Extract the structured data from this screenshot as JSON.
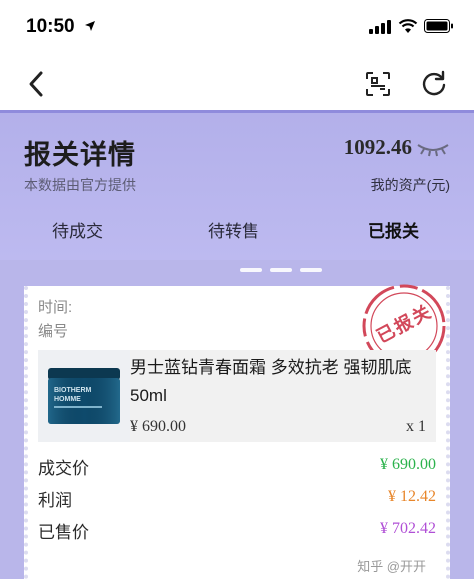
{
  "status_bar": {
    "time": "10:50"
  },
  "header": {
    "title": "报关详情",
    "subtitle": "本数据由官方提供",
    "asset_value": "1092.46",
    "asset_label": "我的资产(元)"
  },
  "tabs": [
    {
      "label": "待成交",
      "active": false
    },
    {
      "label": "待转售",
      "active": false
    },
    {
      "label": "已报关",
      "active": true
    }
  ],
  "card": {
    "time_label": "时间:",
    "id_label": "编号",
    "stamp": "已报关",
    "product": {
      "name": "男士蓝钻青春面霜 多效抗老 强韧肌底50ml",
      "price": "¥ 690.00",
      "quantity": "x 1",
      "image_text": "BIOTHERM HOMME"
    },
    "rows": [
      {
        "label": "成交价",
        "value": "¥ 690.00",
        "color": "#2bb24c"
      },
      {
        "label": "利润",
        "value": "¥ 12.42",
        "color": "#e8862a"
      },
      {
        "label": "已售价",
        "value": "¥ 702.42",
        "color": "#b04fd6"
      }
    ]
  },
  "watermark": "知乎 @开开",
  "colors": {
    "header_bg": "#b9b6ea",
    "stamp": "#d2485a"
  }
}
